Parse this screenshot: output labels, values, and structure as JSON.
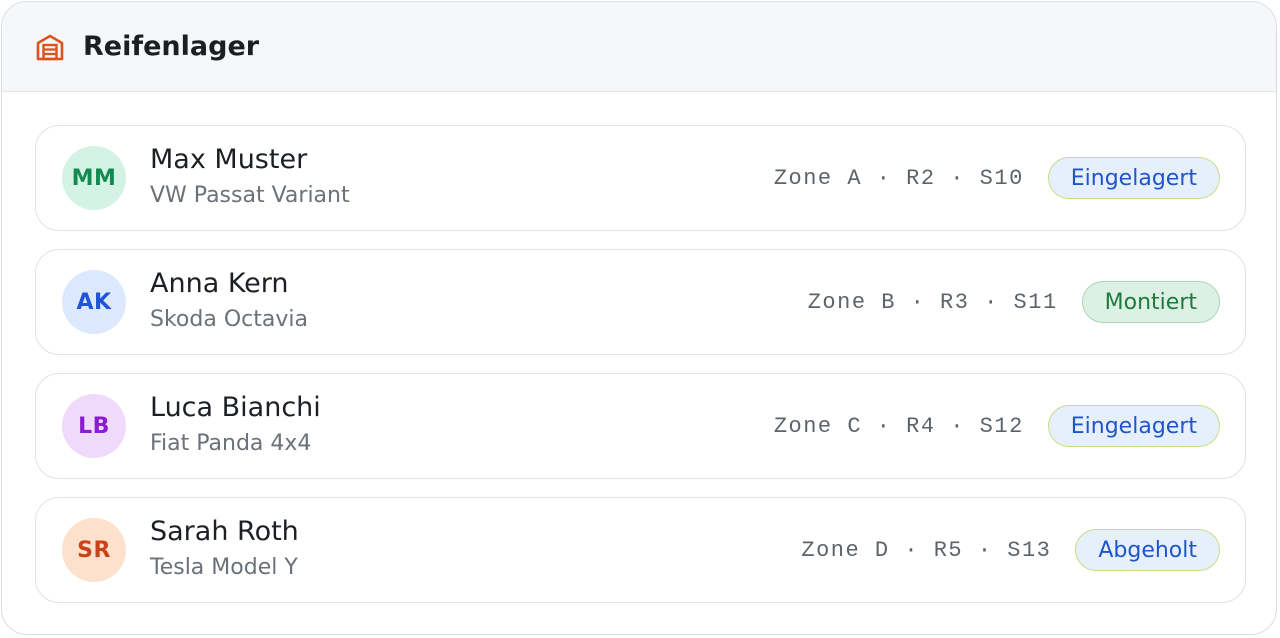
{
  "header": {
    "title": "Reifenlager",
    "icon": "warehouse-icon",
    "icon_color": "#d9541e"
  },
  "rows": [
    {
      "initials": "MM",
      "avatar_bg": "#d4f3e4",
      "avatar_fg": "#138a54",
      "name": "Max Muster",
      "vehicle": "VW Passat Variant",
      "location": "Zone A · R2 · S10",
      "status": "Eingelagert",
      "status_type": "stored"
    },
    {
      "initials": "AK",
      "avatar_bg": "#dce8fd",
      "avatar_fg": "#1f55d6",
      "name": "Anna Kern",
      "vehicle": "Skoda Octavia",
      "location": "Zone B · R3 · S11",
      "status": "Montiert",
      "status_type": "mounted"
    },
    {
      "initials": "LB",
      "avatar_bg": "#efdafc",
      "avatar_fg": "#8a1bd0",
      "name": "Luca Bianchi",
      "vehicle": "Fiat Panda 4x4",
      "location": "Zone C · R4 · S12",
      "status": "Eingelagert",
      "status_type": "stored"
    },
    {
      "initials": "SR",
      "avatar_bg": "#fde1cd",
      "avatar_fg": "#c9431a",
      "name": "Sarah Roth",
      "vehicle": "Tesla Model Y",
      "location": "Zone D · R5 · S13",
      "status": "Abgeholt",
      "status_type": "picked"
    }
  ]
}
